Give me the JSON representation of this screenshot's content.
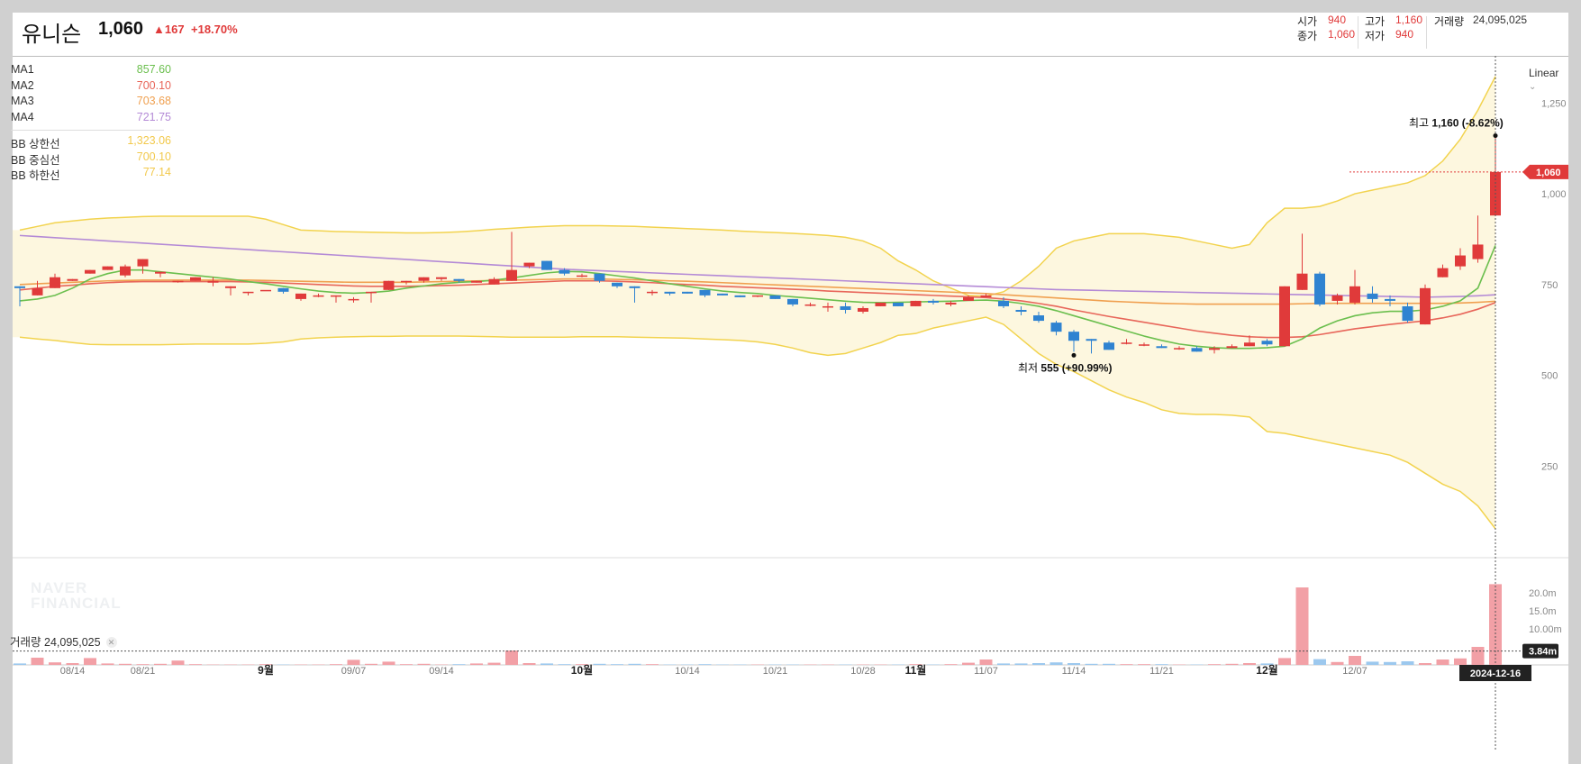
{
  "header": {
    "name": "유니슨",
    "price": "1,060",
    "change": "▲167",
    "change_pct": "+18.70%",
    "open_label": "시가",
    "open": "940",
    "close_label": "종가",
    "close": "1,060",
    "high_label": "고가",
    "high": "1,160",
    "low_label": "저가",
    "low": "940",
    "volume_label": "거래량",
    "volume": "24,095,025"
  },
  "legend": [
    {
      "name": "MA1",
      "value": "857.60",
      "color": "#6bbf4e"
    },
    {
      "name": "MA2",
      "value": "700.10",
      "color": "#e8665a"
    },
    {
      "name": "MA3",
      "value": "703.68",
      "color": "#f0a050"
    },
    {
      "name": "MA4",
      "value": "721.75",
      "color": "#b48ad6"
    },
    {
      "name": "BB 상한선",
      "value": "1,323.06",
      "color": "#f2c94c"
    },
    {
      "name": "BB 중심선",
      "value": "700.10",
      "color": "#f2c94c"
    },
    {
      "name": "BB 하한선",
      "value": "77.14",
      "color": "#f2c94c"
    }
  ],
  "scale_mode": "Linear",
  "watermark": [
    "NAVER",
    "FINANCIAL"
  ],
  "volume_panel": {
    "label": "거래량",
    "value": "24,095,025",
    "ticks": [
      "20.0m",
      "15.0m",
      "10.00m"
    ],
    "current_label": "3.84m"
  },
  "chart_data": {
    "type": "candlestick",
    "y_ticks": [
      250,
      500,
      750,
      1000,
      1250
    ],
    "y_range": [
      0,
      1350
    ],
    "current_price_label": "1,060",
    "high_annotation": {
      "label": "최고",
      "value": "1,160",
      "pct": "(-8.62%)"
    },
    "low_annotation": {
      "label": "최저",
      "value": "555",
      "pct": "(+90.99%)"
    },
    "cursor_date": "2024-12-16",
    "x_ticks": [
      {
        "label": "08/14",
        "i": 3,
        "month": false
      },
      {
        "label": "08/21",
        "i": 7,
        "month": false
      },
      {
        "label": "9월",
        "i": 14,
        "month": true
      },
      {
        "label": "09/07",
        "i": 19,
        "month": false
      },
      {
        "label": "09/14",
        "i": 24,
        "month": false
      },
      {
        "label": "10월",
        "i": 32,
        "month": true
      },
      {
        "label": "10/14",
        "i": 38,
        "month": false
      },
      {
        "label": "10/21",
        "i": 43,
        "month": false
      },
      {
        "label": "10/28",
        "i": 48,
        "month": false
      },
      {
        "label": "11월",
        "i": 51,
        "month": true
      },
      {
        "label": "11/07",
        "i": 55,
        "month": false
      },
      {
        "label": "11/14",
        "i": 60,
        "month": false
      },
      {
        "label": "11/21",
        "i": 65,
        "month": false
      },
      {
        "label": "12월",
        "i": 71,
        "month": true
      },
      {
        "label": "12/07",
        "i": 76,
        "month": false
      }
    ],
    "candles": [
      [
        745,
        740,
        690,
        700
      ],
      [
        720,
        740,
        760,
        760
      ],
      [
        740,
        770,
        755,
        780
      ],
      [
        760,
        765,
        760,
        760
      ],
      [
        780,
        790,
        780,
        780
      ],
      [
        790,
        800,
        790,
        800
      ],
      [
        775,
        800,
        770,
        805
      ],
      [
        800,
        820,
        780,
        815
      ],
      [
        780,
        785,
        770,
        775
      ],
      [
        760,
        760,
        755,
        760
      ],
      [
        760,
        770,
        760,
        760
      ],
      [
        755,
        760,
        745,
        770
      ],
      [
        740,
        745,
        720,
        720
      ],
      [
        730,
        730,
        720,
        720
      ],
      [
        735,
        735,
        735,
        735
      ],
      [
        740,
        730,
        725,
        730
      ],
      [
        710,
        725,
        705,
        720
      ],
      [
        720,
        720,
        715,
        725
      ],
      [
        720,
        720,
        700,
        700
      ],
      [
        710,
        710,
        700,
        715
      ],
      [
        730,
        730,
        700,
        730
      ],
      [
        735,
        760,
        735,
        760
      ],
      [
        760,
        760,
        750,
        760
      ],
      [
        760,
        770,
        755,
        760
      ],
      [
        765,
        770,
        760,
        760
      ],
      [
        765,
        760,
        755,
        760
      ],
      [
        755,
        760,
        775,
        760
      ],
      [
        750,
        765,
        770,
        770
      ],
      [
        760,
        790,
        800,
        895
      ],
      [
        800,
        810,
        795,
        810
      ],
      [
        815,
        790,
        790,
        815
      ],
      [
        790,
        780,
        775,
        795
      ],
      [
        775,
        775,
        770,
        780
      ],
      [
        780,
        760,
        755,
        780
      ],
      [
        755,
        745,
        740,
        750
      ],
      [
        745,
        740,
        700,
        745
      ],
      [
        730,
        730,
        720,
        735
      ],
      [
        730,
        725,
        720,
        730
      ],
      [
        730,
        725,
        725,
        730
      ],
      [
        735,
        720,
        715,
        735
      ],
      [
        725,
        720,
        720,
        725
      ],
      [
        720,
        715,
        715,
        720
      ],
      [
        720,
        720,
        715,
        720
      ],
      [
        720,
        710,
        710,
        720
      ],
      [
        710,
        695,
        690,
        710
      ],
      [
        695,
        695,
        690,
        700
      ],
      [
        690,
        690,
        675,
        700
      ],
      [
        690,
        680,
        670,
        700
      ],
      [
        675,
        685,
        670,
        690
      ],
      [
        690,
        700,
        690,
        700
      ],
      [
        700,
        690,
        690,
        700
      ],
      [
        690,
        705,
        700,
        705
      ],
      [
        705,
        700,
        695,
        710
      ],
      [
        695,
        700,
        690,
        705
      ],
      [
        705,
        715,
        720,
        720
      ],
      [
        715,
        720,
        770,
        725
      ],
      [
        705,
        690,
        685,
        715
      ],
      [
        680,
        675,
        665,
        690
      ],
      [
        665,
        650,
        645,
        675
      ],
      [
        645,
        620,
        610,
        650
      ],
      [
        620,
        595,
        565,
        625
      ],
      [
        600,
        595,
        560,
        600
      ],
      [
        590,
        570,
        570,
        595
      ],
      [
        590,
        590,
        585,
        600
      ],
      [
        585,
        585,
        580,
        590
      ],
      [
        580,
        575,
        575,
        585
      ],
      [
        575,
        575,
        570,
        580
      ],
      [
        575,
        565,
        565,
        580
      ],
      [
        570,
        575,
        560,
        580
      ],
      [
        575,
        580,
        575,
        585
      ],
      [
        580,
        590,
        580,
        610
      ],
      [
        595,
        585,
        580,
        600
      ],
      [
        580,
        745,
        580,
        745
      ],
      [
        735,
        780,
        735,
        890
      ],
      [
        780,
        695,
        690,
        785
      ],
      [
        705,
        720,
        695,
        725
      ],
      [
        700,
        745,
        695,
        790
      ],
      [
        725,
        710,
        700,
        745
      ],
      [
        710,
        705,
        690,
        720
      ],
      [
        690,
        650,
        645,
        700
      ],
      [
        640,
        740,
        640,
        750
      ],
      [
        770,
        795,
        770,
        805
      ],
      [
        800,
        830,
        790,
        850
      ],
      [
        820,
        860,
        810,
        940
      ],
      [
        940,
        1060,
        940,
        1160
      ]
    ],
    "ma": [
      {
        "name": "MA1",
        "values": [
          705,
          710,
          720,
          740,
          765,
          780,
          790,
          790,
          785,
          780,
          775,
          770,
          765,
          758,
          752,
          745,
          738,
          732,
          728,
          726,
          728,
          732,
          740,
          746,
          752,
          756,
          758,
          762,
          768,
          775,
          782,
          786,
          785,
          780,
          774,
          768,
          760,
          752,
          745,
          738,
          732,
          728,
          725,
          720,
          716,
          712,
          708,
          704,
          701,
          700,
          701,
          702,
          703,
          704,
          706,
          707,
          704,
          698,
          690,
          678,
          664,
          650,
          636,
          622,
          608,
          596,
          586,
          580,
          576,
          574,
          574,
          576,
          580,
          600,
          630,
          650,
          664,
          672,
          676,
          676,
          680,
          690,
          705,
          740,
          857.6
        ]
      },
      {
        "name": "MA2",
        "values": [
          735,
          740,
          745,
          748,
          752,
          755,
          757,
          758,
          758,
          758,
          758,
          758,
          758,
          757,
          756,
          754,
          752,
          750,
          748,
          746,
          745,
          745,
          745,
          746,
          747,
          748,
          750,
          752,
          754,
          756,
          758,
          760,
          760,
          760,
          759,
          757,
          755,
          752,
          750,
          748,
          745,
          743,
          741,
          739,
          737,
          735,
          732,
          730,
          728,
          726,
          724,
          722,
          720,
          718,
          716,
          714,
          710,
          705,
          698,
          690,
          680,
          671,
          662,
          654,
          646,
          638,
          630,
          622,
          616,
          610,
          606,
          604,
          604,
          606,
          612,
          620,
          628,
          634,
          640,
          645,
          650,
          658,
          668,
          682,
          700.1
        ]
      },
      {
        "name": "MA3",
        "values": [
          750,
          752,
          754,
          756,
          758,
          760,
          761,
          762,
          762,
          762,
          762,
          762,
          762,
          762,
          761,
          760,
          759,
          758,
          757,
          756,
          756,
          756,
          756,
          757,
          758,
          759,
          760,
          761,
          762,
          763,
          764,
          765,
          765,
          765,
          764,
          763,
          762,
          760,
          759,
          757,
          755,
          753,
          751,
          749,
          747,
          745,
          743,
          741,
          739,
          737,
          735,
          733,
          731,
          729,
          727,
          725,
          722,
          719,
          716,
          713,
          710,
          707,
          704,
          702,
          700,
          698,
          697,
          696,
          696,
          696,
          696,
          696,
          696,
          697,
          698,
          698,
          698,
          698,
          698,
          698,
          698,
          698,
          699,
          701,
          703.68
        ]
      },
      {
        "name": "MA4",
        "values": [
          885,
          882,
          879,
          876,
          873,
          870,
          867,
          864,
          861,
          858,
          855,
          852,
          849,
          846,
          843,
          840,
          837,
          834,
          831,
          828,
          825,
          822,
          819,
          816,
          813,
          810,
          807,
          804,
          801,
          798,
          795,
          792,
          790,
          788,
          786,
          784,
          782,
          780,
          778,
          776,
          774,
          772,
          770,
          768,
          766,
          764,
          762,
          760,
          758,
          756,
          754,
          752,
          750,
          748,
          746,
          744,
          742,
          740,
          738,
          736,
          735,
          734,
          733,
          732,
          731,
          730,
          729,
          728,
          727,
          726,
          725,
          724,
          723,
          722,
          721,
          720,
          719,
          718,
          717,
          716,
          715,
          716,
          717,
          719,
          721.75
        ]
      }
    ],
    "bb_upper": [
      900,
      910,
      920,
      925,
      930,
      933,
      935,
      937,
      938,
      938,
      938,
      938,
      938,
      938,
      930,
      915,
      900,
      898,
      896,
      895,
      894,
      893,
      892,
      892,
      893,
      895,
      898,
      902,
      905,
      908,
      910,
      912,
      912,
      912,
      911,
      910,
      908,
      906,
      904,
      902,
      900,
      897,
      895,
      893,
      891,
      888,
      885,
      880,
      870,
      850,
      815,
      790,
      760,
      740,
      720,
      718,
      730,
      760,
      800,
      850,
      870,
      880,
      890,
      890,
      890,
      885,
      880,
      870,
      860,
      850,
      860,
      920,
      960,
      960,
      965,
      980,
      1000,
      1010,
      1020,
      1030,
      1050,
      1090,
      1150,
      1230,
      1323.06
    ],
    "bb_mid": [
      735,
      740,
      745,
      748,
      752,
      755,
      757,
      758,
      758,
      758,
      758,
      758,
      758,
      757,
      756,
      754,
      752,
      750,
      748,
      746,
      745,
      745,
      745,
      746,
      747,
      748,
      750,
      752,
      754,
      756,
      758,
      760,
      760,
      760,
      759,
      757,
      755,
      752,
      750,
      748,
      745,
      743,
      741,
      739,
      737,
      735,
      732,
      730,
      728,
      726,
      724,
      722,
      720,
      718,
      716,
      714,
      710,
      705,
      698,
      690,
      680,
      671,
      662,
      654,
      646,
      638,
      630,
      622,
      616,
      610,
      606,
      604,
      604,
      606,
      612,
      620,
      628,
      634,
      640,
      645,
      650,
      658,
      668,
      682,
      700.1
    ],
    "bb_lower": [
      605,
      600,
      596,
      590,
      585,
      584,
      584,
      584,
      584,
      585,
      586,
      586,
      586,
      586,
      588,
      592,
      600,
      603,
      605,
      606,
      607,
      607,
      608,
      608,
      608,
      608,
      607,
      606,
      605,
      605,
      605,
      605,
      606,
      606,
      606,
      605,
      604,
      603,
      602,
      600,
      598,
      596,
      592,
      585,
      575,
      562,
      555,
      560,
      575,
      590,
      610,
      615,
      630,
      640,
      650,
      660,
      640,
      600,
      560,
      530,
      510,
      485,
      460,
      440,
      425,
      405,
      395,
      392,
      392,
      390,
      385,
      345,
      340,
      330,
      320,
      310,
      300,
      290,
      280,
      260,
      230,
      200,
      180,
      140,
      77.14
    ],
    "volume": [
      0.4,
      2.0,
      0.7,
      0.5,
      1.9,
      0.4,
      0.3,
      0.2,
      0.3,
      1.2,
      0.2,
      0.1,
      0.1,
      0.1,
      0.2,
      0.1,
      0.1,
      0.1,
      0.2,
      1.4,
      0.3,
      0.9,
      0.2,
      0.3,
      0.1,
      0.2,
      0.4,
      0.6,
      4.0,
      0.5,
      0.4,
      0.2,
      0.2,
      0.3,
      0.2,
      0.3,
      0.2,
      0.1,
      0.1,
      0.2,
      0.1,
      0.1,
      0.1,
      0.1,
      0.1,
      0.1,
      0.1,
      0.1,
      0.1,
      0.1,
      0.1,
      0.2,
      0.1,
      0.2,
      0.6,
      1.5,
      0.4,
      0.4,
      0.5,
      0.7,
      0.5,
      0.3,
      0.3,
      0.2,
      0.2,
      0.2,
      0.1,
      0.1,
      0.2,
      0.3,
      0.5,
      0.4,
      1.9,
      21.5,
      1.6,
      0.8,
      2.5,
      0.9,
      0.8,
      1.0,
      0.5,
      1.5,
      1.8,
      5.0,
      22.4
    ]
  }
}
